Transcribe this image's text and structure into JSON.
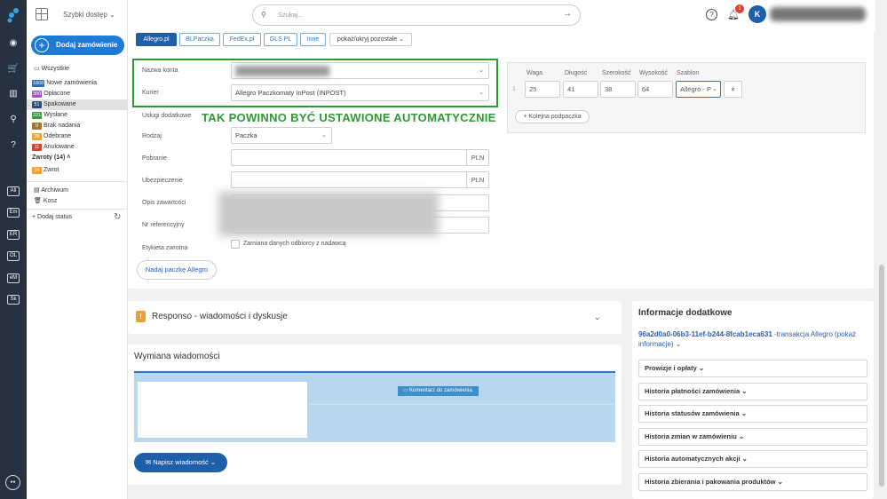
{
  "topbar": {
    "quick_access": "Szybki dostęp",
    "search_placeholder": "Szukaj...",
    "notification_count": "1",
    "avatar_letter": "K"
  },
  "sidebar": {
    "add_order": "Dodaj zamówienie",
    "all": "Wszystkie",
    "statuses": [
      {
        "badge": "1808",
        "label": "Nowe zamówienia",
        "color": "#2b6fb6"
      },
      {
        "badge": "300",
        "label": "Opłacone",
        "color": "#9b59b6"
      },
      {
        "badge": "51",
        "label": "Spakowane",
        "color": "#2f4d6e"
      },
      {
        "badge": "221",
        "label": "Wysłane",
        "color": "#3a9a3a"
      },
      {
        "badge": "0",
        "label": "Brak nadania",
        "color": "#a0782b"
      },
      {
        "badge": "38",
        "label": "Odebrane",
        "color": "#e6a23c"
      },
      {
        "badge": "11",
        "label": "Anulowane",
        "color": "#d9412f"
      }
    ],
    "returns_group": "Zwroty (14)",
    "returns": {
      "badge": "14",
      "label": "Zwrot",
      "color": "#f0a030"
    },
    "archive": "Archiwum",
    "trash": "Kosz",
    "add_status": "+ Dodaj status",
    "icon_tags": [
      "All",
      "Em",
      "ER",
      "OL",
      "eM",
      "Sk"
    ]
  },
  "carriers": {
    "tabs": [
      "Allegro.pl",
      "BLPaczka",
      "FedEx.pl",
      "GLS PL",
      "Inne"
    ],
    "show_hide": "pokaż/ukryj pozostałe"
  },
  "form": {
    "account_label": "Nazwa konta",
    "courier_label": "Kurier",
    "courier_value": "Allegro Paczkomaty InPost (INPOST)",
    "services_label": "Usługi dodatkowe",
    "annotation": "TAK POWINNO BYĆ USTAWIONE AUTOMATYCZNIE",
    "type_label": "Rodzaj",
    "type_value": "Paczka",
    "cod_label": "Pobranie",
    "cod_currency": "PLN",
    "insurance_label": "Ubezpieczenie",
    "insurance_currency": "PLN",
    "content_label": "Opis zawartości",
    "ref_label": "Nr referencyjny",
    "return_label": "Etykieta zwrotna",
    "swap_text": "Zamiana danych odbiorcy z nadawcą",
    "submit": "Nadaj paczkę Allegro"
  },
  "package": {
    "headers": [
      "Waga",
      "Długość",
      "Szerokość",
      "Wysokość",
      "Szablon"
    ],
    "row_num": "1",
    "values": [
      "25",
      "41",
      "38",
      "64"
    ],
    "template": "Allegro - P",
    "next": "+ Kolejna podpaczka"
  },
  "responso": {
    "title": "Responso - wiadomości i dyskusje"
  },
  "messages": {
    "title": "Wymiana wiadomości",
    "comment": "Komentarz do zamówienia.",
    "write": "Napisz wiadomość"
  },
  "info": {
    "title": "Informacje dodatkowe",
    "tx_id": "96a2d0a0-06b3-11ef-b244-8fcab1eca631",
    "tx_suffix": "-transakcja Allegro (pokaż informacje)",
    "sections": [
      "Prowizje i opłaty",
      "Historia płatności zamówienia",
      "Historia statusów zamówienia",
      "Historia zmian w zamówieniu",
      "Historia automatycznych akcji",
      "Historia zbierania i pakowania produktów"
    ]
  },
  "colors": {
    "accent": "#1f7ad6",
    "highlight": "#2e9a34",
    "sidebar": "#26323f"
  }
}
